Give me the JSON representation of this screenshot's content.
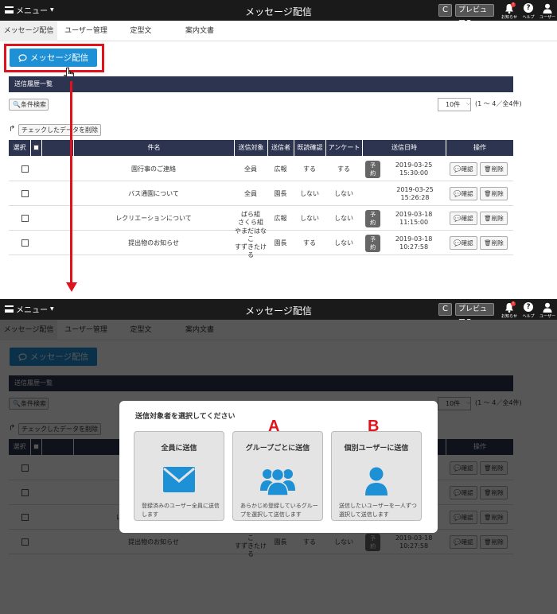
{
  "topbar": {
    "menu_label": "メニュー",
    "title": "メッセージ配信",
    "refresh_glyph": "C",
    "preview_label": "プレビュー",
    "bell_label": "お知らせ",
    "bell_badge": "!",
    "help_glyph": "?",
    "help_label": "ヘルプ",
    "user_label": "ユーザー"
  },
  "tabs": [
    "メッセージ配信",
    "ユーザー管理",
    "定型文",
    "案内文書"
  ],
  "main": {
    "send_button_label": "メッセージ配信",
    "history_heading": "送信履歴一覧",
    "search_button_label": "条件検索",
    "per_page_value": "10件",
    "count_text": "(1 ～ 4／全4件)",
    "delete_checked_label": "チェックしたデータを削除"
  },
  "table": {
    "headers": [
      "選択",
      "件名",
      "送信対象",
      "送信者",
      "既読確認",
      "アンケート",
      "送信日時",
      "操作"
    ],
    "scheduled_badge": "予約",
    "confirm_label": "確認",
    "delete_label": "削除",
    "rows": [
      {
        "subject": "園行事のご連絡",
        "target_1": "全員",
        "target_2": "",
        "sender": "広報",
        "read_check": "する",
        "survey": "する",
        "scheduled": true,
        "datetime": "2019-03-25 15:30:00"
      },
      {
        "subject": "バス通園について",
        "target_1": "全員",
        "target_2": "",
        "sender": "園長",
        "read_check": "しない",
        "survey": "しない",
        "scheduled": false,
        "datetime": "2019-03-25 15:26:28"
      },
      {
        "subject": "レクリエーションについて",
        "target_1": "ばら組",
        "target_2": "さくら組",
        "sender": "広報",
        "read_check": "しない",
        "survey": "しない",
        "scheduled": true,
        "datetime": "2019-03-18 11:15:00"
      },
      {
        "subject": "提出物のお知らせ",
        "target_1": "やまだはなこ",
        "target_2": "すずきたける",
        "sender": "園長",
        "read_check": "する",
        "survey": "しない",
        "scheduled": true,
        "datetime": "2019-03-18 10:27:58"
      }
    ]
  },
  "modal": {
    "title": "送信対象者を選択してください",
    "options": [
      {
        "title": "全員に送信",
        "desc": "登録済みのユーザー全員に送信します",
        "icon": "envelope-icon"
      },
      {
        "title": "グループごとに送信",
        "desc": "あらかじめ登録しているグループを選択して送信します",
        "icon": "group-icon"
      },
      {
        "title": "個別ユーザーに送信",
        "desc": "送信したいユーザーを一人ずつ選択して送信します",
        "icon": "person-icon"
      }
    ]
  },
  "annotations": {
    "letter_a": "A",
    "letter_b": "B"
  },
  "colors": {
    "accent_blue": "#1e90d6",
    "header_navy": "#2d3450",
    "annotation_red": "#e0131c",
    "topbar": "#1a1a1a"
  }
}
